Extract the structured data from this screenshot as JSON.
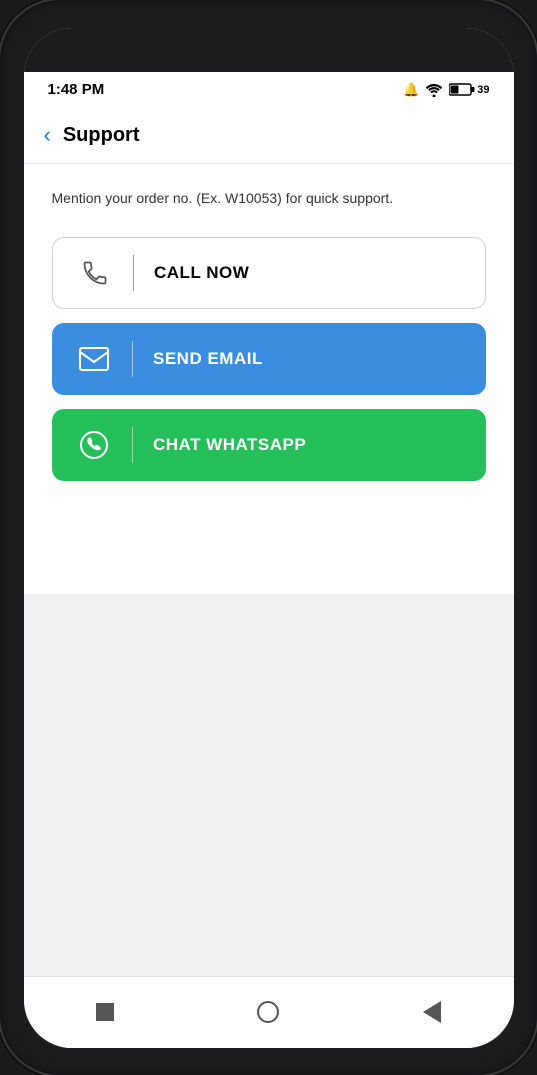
{
  "status_bar": {
    "time": "1:48 PM",
    "bell_icon": "bell-icon",
    "wifi_icon": "wifi-icon",
    "battery_text": "39",
    "battery_icon": "battery-icon"
  },
  "header": {
    "back_label": "‹",
    "title": "Support"
  },
  "main": {
    "description": "Mention your order no. (Ex. W10053) for quick support.",
    "call_button_label": "CALL NOW",
    "email_button_label": "SEND EMAIL",
    "whatsapp_button_label": "CHAT WHATSAPP"
  },
  "bottom_nav": {
    "square_icon": "square-icon",
    "circle_icon": "home-icon",
    "back_icon": "back-nav-icon"
  },
  "colors": {
    "call_bg": "#ffffff",
    "email_bg": "#3b8de0",
    "whatsapp_bg": "#25c05a"
  }
}
